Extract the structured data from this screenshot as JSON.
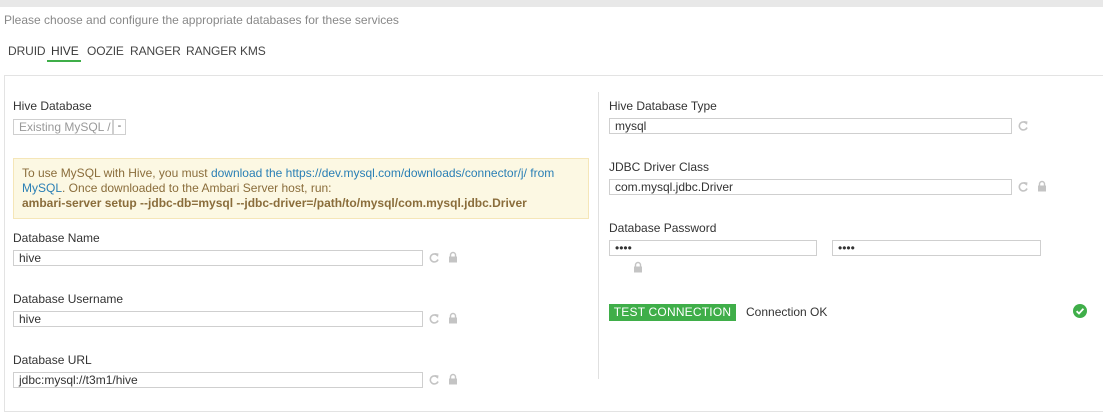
{
  "instructions": "Please choose and configure the appropriate databases for these services",
  "tabs": [
    "DRUID",
    "HIVE",
    "OOZIE",
    "RANGER",
    "RANGER KMS"
  ],
  "active_tab": "HIVE",
  "left": {
    "hive_database": {
      "label": "Hive Database",
      "value": "Existing MySQL / MariaDB",
      "caret": "-"
    },
    "warning": {
      "prefix": "To use MySQL with Hive, you must ",
      "link_text": "download the https://dev.mysql.com/downloads/connector/j/ from MySQL",
      "suffix": ". Once downloaded to the Ambari Server host, run:",
      "command": "ambari-server setup --jdbc-db=mysql --jdbc-driver=/path/to/mysql/com.mysql.jdbc.Driver"
    },
    "database_name": {
      "label": "Database Name",
      "value": "hive"
    },
    "database_username": {
      "label": "Database Username",
      "value": "hive"
    },
    "database_url": {
      "label": "Database URL",
      "value": "jdbc:mysql://t3m1/hive"
    }
  },
  "right": {
    "database_type": {
      "label": "Hive Database Type",
      "value": "mysql"
    },
    "jdbc_driver": {
      "label": "JDBC Driver Class",
      "value": "com.mysql.jdbc.Driver"
    },
    "database_password": {
      "label": "Database Password",
      "value": "••••",
      "confirm_value": "••••"
    },
    "test_button": "TEST CONNECTION",
    "connection_status": "Connection OK"
  },
  "colors": {
    "accent": "#3fae49",
    "link": "#2a7fb5",
    "warning_bg": "#fcf8e3",
    "icon_grey": "#c4c4c4"
  }
}
